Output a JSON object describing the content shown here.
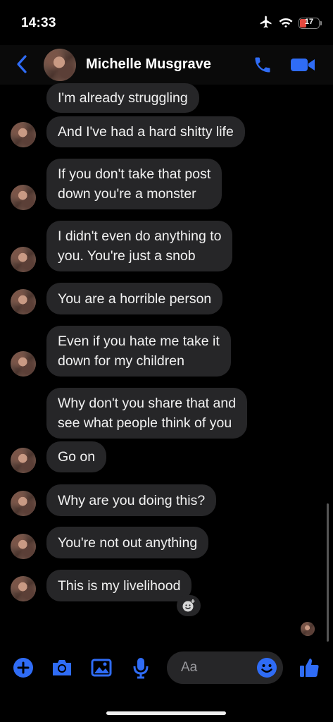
{
  "status_bar": {
    "time": "14:33",
    "battery": "17",
    "icons": [
      "airplane-icon",
      "wifi-icon",
      "battery-icon"
    ]
  },
  "header": {
    "contact_name": "Michelle Musgrave",
    "icons": [
      "back-chevron-icon",
      "phone-icon",
      "video-camera-icon"
    ]
  },
  "messages": [
    {
      "lines": [
        "I'm already struggling"
      ]
    },
    {
      "lines": [
        "And I've had a hard shitty life"
      ]
    },
    {
      "lines": [
        "If you don't take that post",
        "down you're a monster"
      ]
    },
    {
      "lines": [
        "I didn't even do anything to",
        "you. You're just a snob"
      ]
    },
    {
      "lines": [
        "You are a horrible person"
      ]
    },
    {
      "lines": [
        "Even if you hate me take it",
        "down for my children"
      ]
    },
    {
      "lines": [
        "Why don't you share that and",
        "see what people think of you"
      ]
    },
    {
      "lines": [
        "Go on"
      ]
    },
    {
      "lines": [
        "Why are you doing this?"
      ]
    },
    {
      "lines": [
        "You're not out anything"
      ]
    },
    {
      "lines": [
        "This is my livelihood"
      ]
    }
  ],
  "composer": {
    "placeholder": "Aa",
    "icons": [
      "plus-icon",
      "camera-icon",
      "image-icon",
      "microphone-icon",
      "emoji-icon",
      "thumbs-up-icon"
    ]
  },
  "colors": {
    "accent": "#2f6cf6",
    "bubble": "#262628",
    "background": "#000000"
  }
}
